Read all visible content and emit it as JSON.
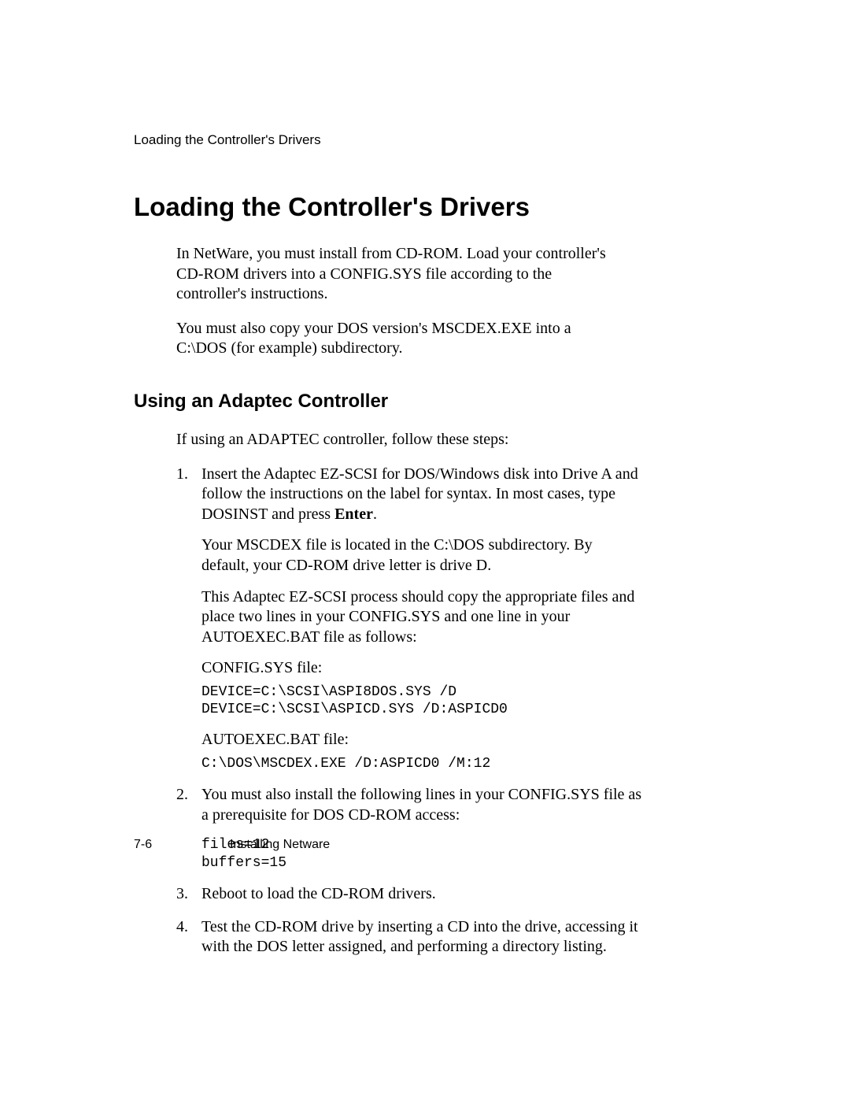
{
  "runningHead": "Loading the Controller's Drivers",
  "title": "Loading the Controller's Drivers",
  "intro": {
    "p1": "In NetWare, you must install from CD-ROM. Load your controller's CD-ROM drivers into a CONFIG.SYS file according to the controller's instructions.",
    "p2": "You must also copy your DOS version's MSCDEX.EXE into a C:\\DOS (for example) subdirectory."
  },
  "subtitle": "Using an Adaptec Controller",
  "lead": "If using an ADAPTEC controller, follow these steps:",
  "steps": {
    "s1": {
      "p1a": "Insert the Adaptec EZ-SCSI for DOS/Windows disk into Drive A and follow the instructions on the label for syntax. In most cases, type DOSINST and press ",
      "p1bold": "Enter",
      "p1b": ".",
      "p2": "Your MSCDEX file is located in the C:\\DOS subdirectory. By default, your CD-ROM drive letter is drive D.",
      "p3": "This Adaptec EZ-SCSI process should copy the appropriate files and place two lines in your CONFIG.SYS and one line in your AUTOEXEC.BAT file as follows:",
      "configLabel": "CONFIG.SYS file:",
      "configCode": "DEVICE=C:\\SCSI\\ASPI8DOS.SYS /D\nDEVICE=C:\\SCSI\\ASPICD.SYS /D:ASPICD0",
      "autoLabel": "AUTOEXEC.BAT file:",
      "autoCode": "C:\\DOS\\MSCDEX.EXE /D:ASPICD0 /M:12"
    },
    "s2": {
      "p1": "You must also install the following lines in your CONFIG.SYS file as a prerequisite for DOS CD-ROM access:",
      "code": "files=12\nbuffers=15"
    },
    "s3": "Reboot to load the CD-ROM drivers.",
    "s4": "Test the CD-ROM drive by inserting a CD into the drive, accessing it with the DOS letter assigned, and performing a directory listing."
  },
  "footer": {
    "pageNum": "7-6",
    "section": "Installing Netware"
  }
}
